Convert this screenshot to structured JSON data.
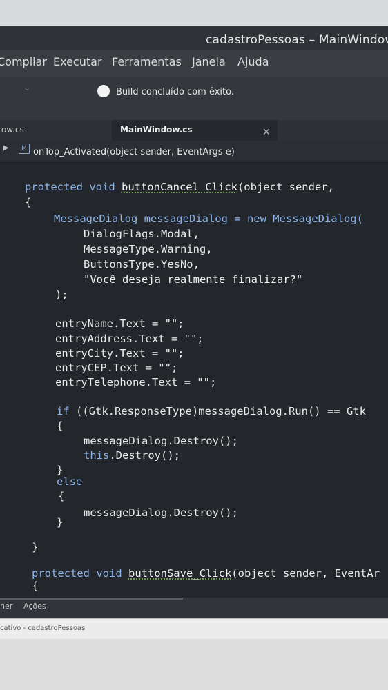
{
  "window": {
    "title": "cadastroPessoas – MainWindow"
  },
  "menu": {
    "items": [
      "Compilar",
      "Executar",
      "Ferramentas",
      "Janela",
      "Ajuda"
    ]
  },
  "status": {
    "message": "Build concluído com êxito."
  },
  "tabs": {
    "inactive_label": "ow.cs",
    "active_label": "MainWindow.cs"
  },
  "breadcrumb": {
    "member": "onTop_Activated(object sender, EventArgs e)"
  },
  "code": {
    "l1_kw": "protected void ",
    "l1_fn": "buttonCancel_Click",
    "l1_rest": "(object sender,",
    "open_brace": "{",
    "l3_type": "MessageDialog messageDialog = ",
    "l3_new": "new",
    "l3_rest": " MessageDialog(",
    "l4": "DialogFlags.Modal,",
    "l5": "MessageType.Warning,",
    "l6": "ButtonsType.YesNo,",
    "l7": "\"Você deseja realmente finalizar?\"",
    "l8": ");",
    "l9": "entryName.Text = \"\";",
    "l10": "entryAddress.Text = \"\";",
    "l11": "entryCity.Text = \"\";",
    "l12": "entryCEP.Text = \"\";",
    "l13": "entryTelephone.Text = \"\";",
    "l14_kw": "if",
    "l14_rest": " ((Gtk.ResponseType)messageDialog.Run() == Gtk",
    "l15": "{",
    "l16": "messageDialog.Destroy();",
    "l17_kw": "this",
    "l17_rest": ".Destroy();",
    "l18": "}",
    "l19_kw": "else",
    "l20": "{",
    "l21": "messageDialog.Destroy();",
    "l22": "}",
    "l23": "}",
    "l24_kw": "protected void ",
    "l24_fn": "buttonSave_Click",
    "l24_rest": "(object sender, EventAr",
    "l25": "{"
  },
  "bottom": {
    "tab1": "ner",
    "tab2": "Ações"
  },
  "taskbar": {
    "item": "cativo - cadastroPessoas"
  },
  "colors": {
    "keyword": "#8cb4ea",
    "editor_bg": "#23262a",
    "squiggle": "#8fbf5f"
  }
}
